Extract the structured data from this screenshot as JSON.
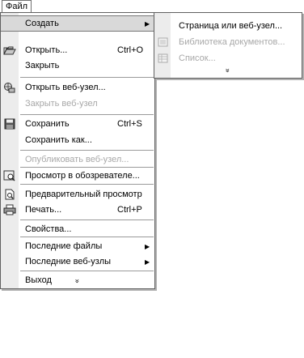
{
  "menubar": {
    "file_label": "Файл"
  },
  "file_menu": {
    "create": "Создать",
    "open": "Открыть...",
    "open_shortcut": "Ctrl+O",
    "close": "Закрыть",
    "open_web": "Открыть веб-узел...",
    "close_web": "Закрыть веб-узел",
    "save": "Сохранить",
    "save_shortcut": "Ctrl+S",
    "save_as": "Сохранить как...",
    "publish_web": "Опубликовать веб-узел...",
    "preview_browser": "Просмотр в обозревателе...",
    "print_preview": "Предварительный просмотр",
    "print": "Печать...",
    "print_shortcut": "Ctrl+P",
    "properties": "Свойства...",
    "recent_files": "Последние файлы",
    "recent_webs": "Последние веб-узлы",
    "exit": "Выход",
    "expand_glyph": "»"
  },
  "create_submenu": {
    "page_or_web": "Страница или веб-узел...",
    "doc_library": "Библиотека документов...",
    "list": "Список...",
    "expand_glyph": "»"
  },
  "colors": {
    "highlight": "#d9d9d9",
    "icon_column": "#ececec",
    "disabled_text": "#a8a8a8"
  }
}
